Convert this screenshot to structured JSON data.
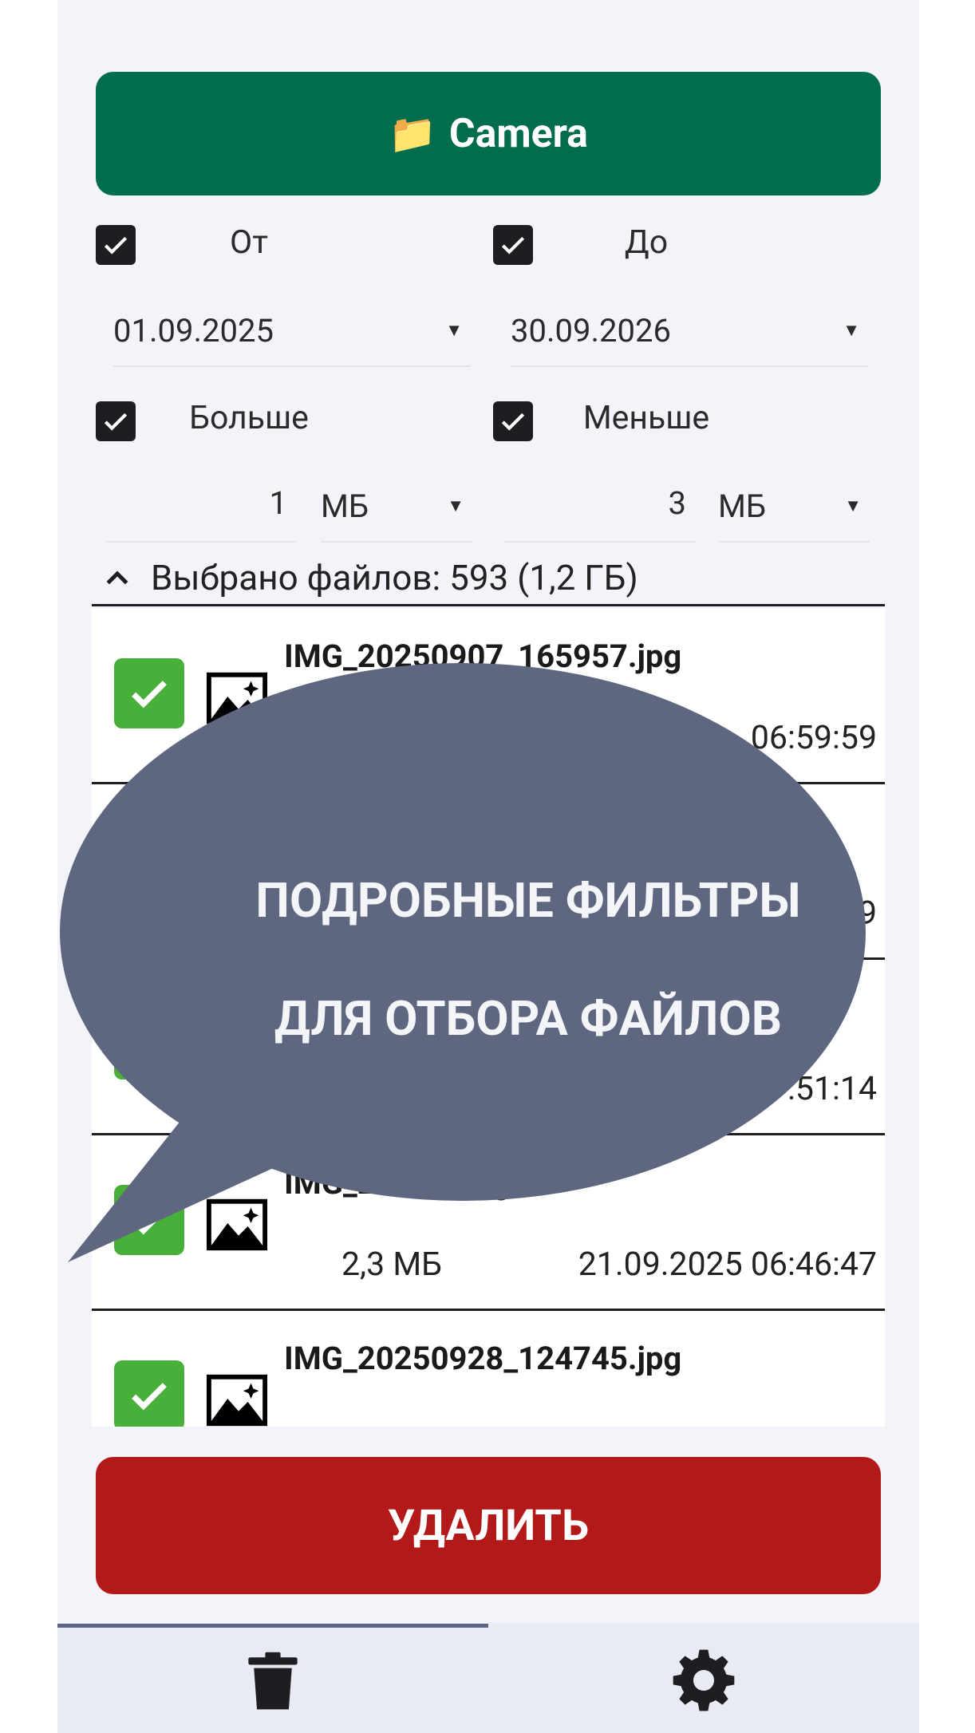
{
  "folder_button": {
    "icon": "📁",
    "label": "Camera"
  },
  "filters": {
    "from": {
      "label": "От",
      "checked": true,
      "date": "01.09.2025"
    },
    "to": {
      "label": "До",
      "checked": true,
      "date": "30.09.2026"
    },
    "larger": {
      "label": "Больше",
      "checked": true,
      "value": "1",
      "unit": "МБ"
    },
    "smaller": {
      "label": "Меньше",
      "checked": true,
      "value": "3",
      "unit": "МБ"
    }
  },
  "summary": {
    "text": "Выбрано файлов: 593 (1,2 ГБ)"
  },
  "files": [
    {
      "name": "IMG_20250907_165957.jpg",
      "size": "",
      "date": "06:59:59"
    },
    {
      "name": "",
      "size": "",
      "date": "9"
    },
    {
      "name": "",
      "size": "",
      "date": ":51:14"
    },
    {
      "name": "IMG_2 4646.jpg",
      "size": "2,3 МБ",
      "date": "21.09.2025 06:46:47"
    },
    {
      "name": "IMG_20250928_124745.jpg",
      "size": "",
      "date": ""
    }
  ],
  "callout": {
    "line1": "ПОДРОБНЫЕ ФИЛЬТРЫ",
    "line2": "ДЛЯ ОТБОРА ФАЙЛОВ",
    "color": "#5f6780"
  },
  "delete_button": {
    "label": "УДАЛИТЬ"
  },
  "bottom_nav": {
    "tabs": [
      "trash-icon",
      "gear-icon"
    ],
    "active": 0
  },
  "colors": {
    "primary_green": "#026d4e",
    "danger_red": "#b41919",
    "check_green": "#48b03a"
  }
}
